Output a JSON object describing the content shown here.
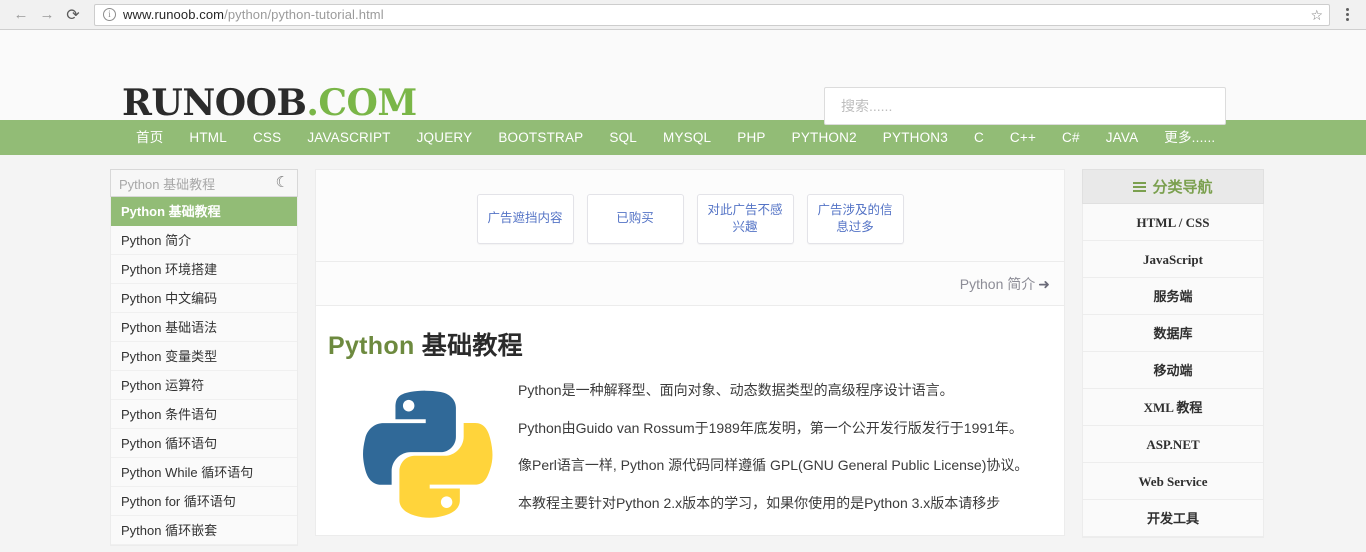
{
  "browser": {
    "back_icon": "←",
    "forward_icon": "→",
    "reload_icon": "⟳",
    "info_icon": "i",
    "url_host": "www.runoob.com",
    "url_path": "/python/python-tutorial.html",
    "star_icon": "☆",
    "menu_icon": "kebab-menu-icon"
  },
  "header": {
    "logo_dark": "RUNOOB",
    "logo_green": ".COM",
    "search_placeholder": "搜索......",
    "search_value": ""
  },
  "nav": {
    "items": [
      "首页",
      "HTML",
      "CSS",
      "JAVASCRIPT",
      "JQUERY",
      "BOOTSTRAP",
      "SQL",
      "MYSQL",
      "PHP",
      "PYTHON2",
      "PYTHON3",
      "C",
      "C++",
      "C#",
      "JAVA",
      "更多......"
    ]
  },
  "left_sidebar": {
    "search_text": "Python 基础教程",
    "moon_icon": "☾",
    "items": [
      {
        "label": "Python 基础教程",
        "active": true
      },
      {
        "label": "Python 简介",
        "active": false
      },
      {
        "label": "Python 环境搭建",
        "active": false
      },
      {
        "label": "Python 中文编码",
        "active": false
      },
      {
        "label": "Python 基础语法",
        "active": false
      },
      {
        "label": "Python 变量类型",
        "active": false
      },
      {
        "label": "Python 运算符",
        "active": false
      },
      {
        "label": "Python 条件语句",
        "active": false
      },
      {
        "label": "Python 循环语句",
        "active": false
      },
      {
        "label": "Python While 循环语句",
        "active": false
      },
      {
        "label": "Python for 循环语句",
        "active": false
      },
      {
        "label": "Python 循环嵌套",
        "active": false
      }
    ]
  },
  "ad_panel": {
    "buttons": [
      "广告遮挡内容",
      "已购买",
      "对此广告不感兴趣",
      "广告涉及的信息过多"
    ]
  },
  "next_nav": {
    "label": "Python 简介",
    "arrow": "➜"
  },
  "article": {
    "title_en": "Python",
    "title_zh": "基础教程",
    "logo_alt": "python-logo",
    "paragraphs": [
      "Python是一种解释型、面向对象、动态数据类型的高级程序设计语言。",
      "Python由Guido van Rossum于1989年底发明，第一个公开发行版发行于1991年。",
      "像Perl语言一样, Python 源代码同样遵循 GPL(GNU General Public License)协议。",
      "本教程主要针对Python 2.x版本的学习，如果你使用的是Python 3.x版本请移步"
    ]
  },
  "right_sidebar": {
    "title": "分类导航",
    "items": [
      "HTML / CSS",
      "JavaScript",
      "服务端",
      "数据库",
      "移动端",
      "XML 教程",
      "ASP.NET",
      "Web Service",
      "开发工具"
    ]
  },
  "colors": {
    "brand_green": "#92bc76",
    "logo_green": "#7ab648",
    "ad_blue": "#5574c6",
    "title_olive": "#6d8a3f"
  }
}
